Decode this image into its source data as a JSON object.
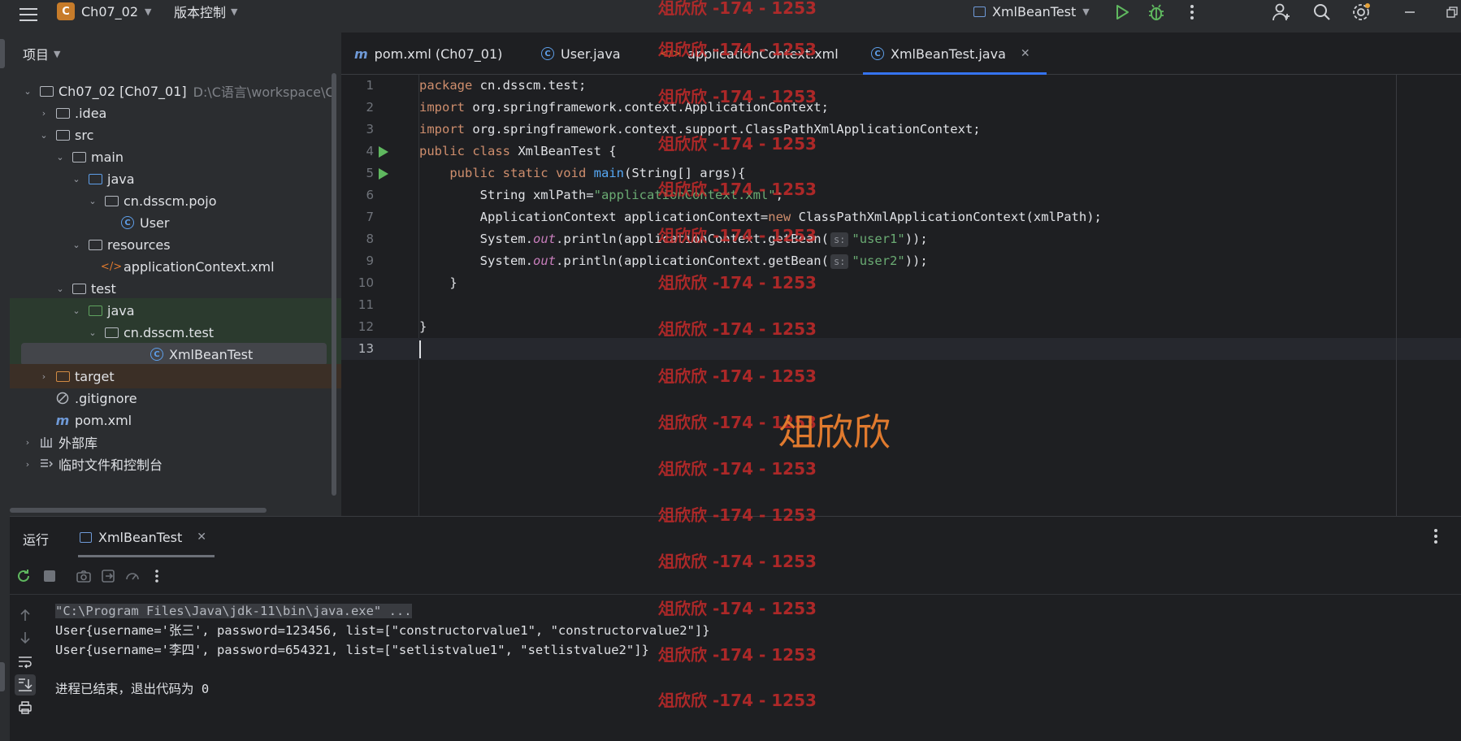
{
  "titlebar": {
    "project_badge": "C",
    "project_name": "Ch07_02",
    "vcs_label": "版本控制",
    "run_config": "XmlBeanTest"
  },
  "project_panel": {
    "title": "项目",
    "tree": [
      {
        "label": "Ch07_02 [Ch07_01]",
        "extra": "D:\\C语言\\workspace\\C",
        "icon": "module-folder-icon",
        "arrow": "expanded",
        "depth": 0
      },
      {
        "label": ".idea",
        "icon": "folder-icon",
        "arrow": "collapsed",
        "depth": 1
      },
      {
        "label": "src",
        "icon": "folder-icon",
        "arrow": "expanded",
        "depth": 1
      },
      {
        "label": "main",
        "icon": "folder-icon",
        "arrow": "expanded",
        "depth": 2
      },
      {
        "label": "java",
        "icon": "source-folder-icon",
        "arrow": "expanded",
        "depth": 3
      },
      {
        "label": "cn.dsscm.pojo",
        "icon": "package-icon",
        "arrow": "expanded",
        "depth": 4
      },
      {
        "label": "User",
        "icon": "class-icon",
        "arrow": "none",
        "depth": 5
      },
      {
        "label": "resources",
        "icon": "resources-folder-icon",
        "arrow": "expanded",
        "depth": 3
      },
      {
        "label": "applicationContext.xml",
        "icon": "xml-file-icon",
        "arrow": "none",
        "depth": 4
      },
      {
        "label": "test",
        "icon": "folder-icon",
        "arrow": "expanded",
        "depth": 2
      },
      {
        "label": "java",
        "icon": "test-folder-icon",
        "arrow": "expanded",
        "depth": 3
      },
      {
        "label": "cn.dsscm.test",
        "icon": "package-icon",
        "arrow": "expanded",
        "depth": 4
      },
      {
        "label": "XmlBeanTest",
        "icon": "class-icon",
        "arrow": "none",
        "depth": 5
      },
      {
        "label": "target",
        "icon": "excluded-folder-icon",
        "arrow": "collapsed",
        "depth": 1
      },
      {
        "label": ".gitignore",
        "icon": "ignore-file-icon",
        "arrow": "none",
        "depth": 1
      },
      {
        "label": "pom.xml",
        "icon": "maven-file-icon",
        "arrow": "none",
        "depth": 1
      },
      {
        "label": "外部库",
        "icon": "library-icon",
        "arrow": "collapsed",
        "depth": 0
      },
      {
        "label": "临时文件和控制台",
        "icon": "scratch-icon",
        "arrow": "collapsed",
        "depth": 0
      }
    ]
  },
  "editor": {
    "tabs": [
      {
        "label": "pom.xml (Ch07_01)",
        "icon": "maven-file-icon"
      },
      {
        "label": "User.java",
        "icon": "class-icon"
      },
      {
        "label": "applicationContext.xml",
        "icon": "xml-file-icon"
      },
      {
        "label": "XmlBeanTest.java",
        "icon": "class-icon",
        "active": true
      }
    ],
    "line_numbers": [
      "1",
      "2",
      "3",
      "4",
      "5",
      "6",
      "7",
      "8",
      "9",
      "10",
      "11",
      "12",
      "13"
    ],
    "code": {
      "l1_kw": "package",
      "l1_rest": " cn.dsscm.test;",
      "l2_kw": "import",
      "l2_rest": " org.springframework.context.ApplicationContext;",
      "l3_kw": "import",
      "l3_rest": " org.springframework.context.support.ClassPathXmlApplicationContext;",
      "l4_kw": "public class",
      "l4_rest": " XmlBeanTest {",
      "l5_indent": "    ",
      "l5_kw": "public static void",
      "l5_fn": "main",
      "l5_rest": "(String[] args){",
      "l6_a": "        String xmlPath=",
      "l6_str": "\"applicationContext.xml\"",
      "l6_b": ";",
      "l7_a": "        ApplicationContext applicationContext=",
      "l7_kw": "new",
      "l7_b": " ClassPathXmlApplicationContext(xmlPath);",
      "l8_a": "        System.",
      "l8_stat": "out",
      "l8_b": ".println(applicationContext.getBean(",
      "l8_hint": "s:",
      "l8_str": "\"user1\"",
      "l8_c": "));",
      "l9_a": "        System.",
      "l9_stat": "out",
      "l9_b": ".println(applicationContext.getBean(",
      "l9_hint": "s:",
      "l9_str": "\"user2\"",
      "l9_c": "));",
      "l10": "    }",
      "l12": "}"
    }
  },
  "run_panel": {
    "title": "运行",
    "tab_label": "XmlBeanTest",
    "console": [
      "\"C:\\Program Files\\Java\\jdk-11\\bin\\java.exe\" ...",
      "User{username='张三', password=123456, list=[\"constructorvalue1\", \"constructorvalue2\"]}",
      "User{username='李四', password=654321, list=[\"setlistvalue1\", \"setlistvalue2\"]}",
      "进程已结束，退出代码为 0"
    ]
  },
  "watermark": {
    "text": "俎欣欣 -174 - 1253",
    "big_text": "俎欣欣"
  }
}
